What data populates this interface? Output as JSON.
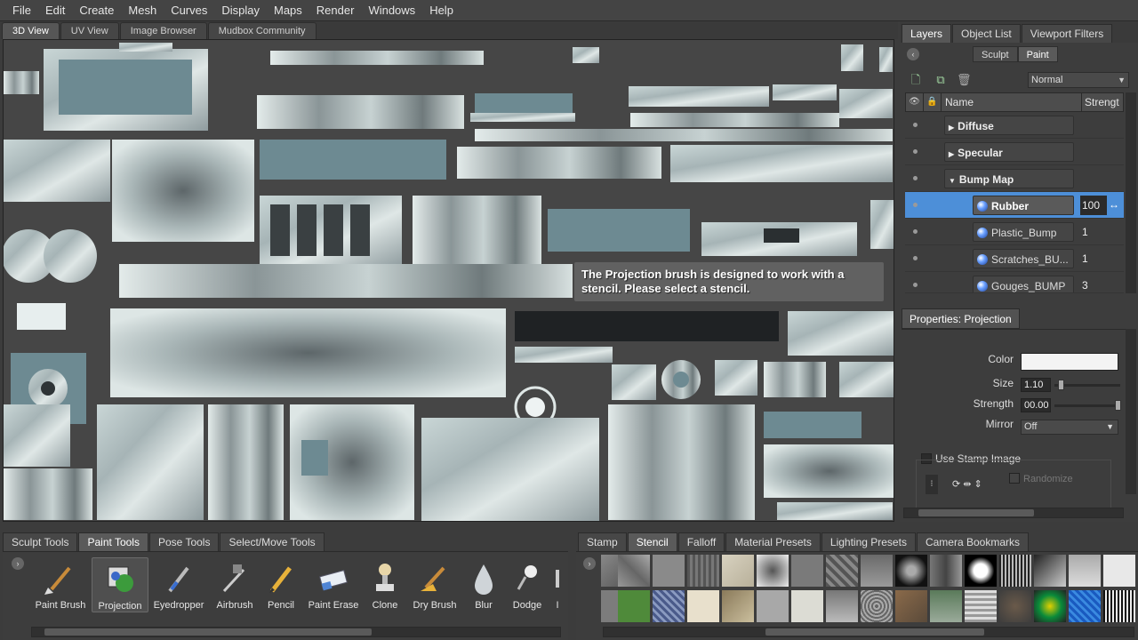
{
  "menu": [
    "File",
    "Edit",
    "Create",
    "Mesh",
    "Curves",
    "Display",
    "Maps",
    "Render",
    "Windows",
    "Help"
  ],
  "view_tabs": [
    "3D View",
    "UV View",
    "Image Browser",
    "Mudbox Community"
  ],
  "viewport": {
    "tooltip": "The Projection brush is designed to work with a stencil. Please select a stencil."
  },
  "right_tabs": [
    "Layers",
    "Object List",
    "Viewport Filters"
  ],
  "mode": {
    "sculpt": "Sculpt",
    "paint": "Paint"
  },
  "blend_mode": "Normal",
  "layer_table": {
    "col_name": "Name",
    "col_strength": "Strengt",
    "rows": [
      {
        "name": "Diffuse",
        "strength": ""
      },
      {
        "name": "Specular",
        "strength": ""
      },
      {
        "name": "Bump Map",
        "strength": ""
      },
      {
        "name": "Rubber",
        "strength": "100"
      },
      {
        "name": "Plastic_Bump",
        "strength": "1"
      },
      {
        "name": "Scratches_BU...",
        "strength": "1"
      },
      {
        "name": "Gouges_BUMP",
        "strength": "3"
      }
    ]
  },
  "properties": {
    "tab": "Properties: Projection",
    "color_label": "Color",
    "size_label": "Size",
    "size_value": "1.10",
    "strength_label": "Strength",
    "strength_value": "00.00",
    "mirror_label": "Mirror",
    "mirror_value": "Off",
    "use_stamp": "Use Stamp Image",
    "randomize": "Randomize"
  },
  "tool_tabs": [
    "Sculpt Tools",
    "Paint Tools",
    "Pose Tools",
    "Select/Move Tools"
  ],
  "tools": [
    "Paint Brush",
    "Projection",
    "Eyedropper",
    "Airbrush",
    "Pencil",
    "Paint Erase",
    "Clone",
    "Dry Brush",
    "Blur",
    "Dodge",
    "I"
  ],
  "stamp_tabs": [
    "Stamp",
    "Stencil",
    "Falloff",
    "Material Presets",
    "Lighting Presets",
    "Camera Bookmarks"
  ],
  "colors": {
    "accent": "#4d8fd8",
    "bg": "#3d3d3d"
  }
}
